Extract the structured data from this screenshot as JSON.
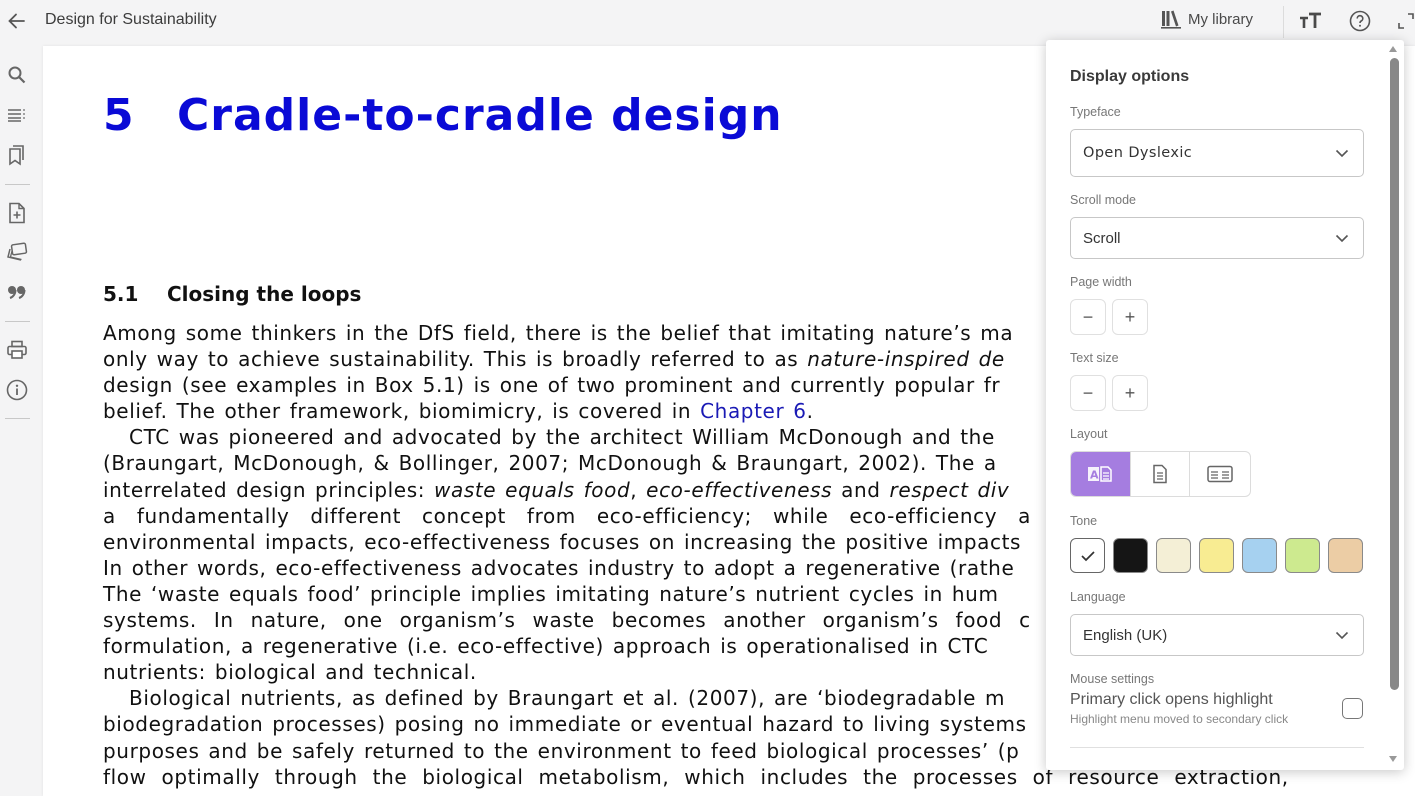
{
  "header": {
    "title": "Design for Sustainability",
    "my_library": "My library",
    "icons": [
      "back-arrow-icon",
      "library-icon",
      "text-size-icon",
      "help-icon",
      "fullscreen-icon"
    ]
  },
  "sidebar": {
    "items": [
      {
        "name": "search",
        "icon": "search-icon"
      },
      {
        "name": "contents",
        "icon": "table-of-contents-icon"
      },
      {
        "name": "bookmarks",
        "icon": "bookmarks-icon"
      },
      {
        "name": "add-note",
        "icon": "add-document-icon"
      },
      {
        "name": "flashcards",
        "icon": "cards-stack-icon"
      },
      {
        "name": "citation",
        "icon": "quote-icon"
      },
      {
        "name": "print",
        "icon": "printer-icon"
      },
      {
        "name": "info",
        "icon": "info-icon"
      }
    ]
  },
  "document": {
    "chapter_number": "5",
    "chapter_title": "Cradle-to-cradle design",
    "section_number": "5.1",
    "section_title": "Closing the loops",
    "p1": {
      "l1": "Among some thinkers in the DfS field, there is the belief that imitating nature’s ma",
      "l2a": "only way to achieve sustainability. This is broadly referred to as ",
      "l2b": "nature-inspired de",
      "l3": "design (see examples in Box 5.1) is one of two prominent and currently popular fr",
      "l4a": "belief. The other framework, biomimicry, is covered in ",
      "l4link": "Chapter 6",
      "l4b": "."
    },
    "p2": {
      "l1": "CTC was pioneered and advocated by the architect William McDonough and the",
      "l2": "(Braungart, McDonough, & Bollinger, 2007; McDonough & Braungart, 2002). The a",
      "l3a": "interrelated design principles: ",
      "l3b": "waste equals food",
      "l3c": ", ",
      "l3d": "eco-effectiveness",
      "l3e": " and ",
      "l3f": "respect div",
      "l4": "a fundamentally different concept from eco-efficiency; while eco-efficiency a",
      "l5": "environmental impacts, eco-effectiveness focuses on increasing the positive impacts",
      "l6": "In other words, eco-effectiveness advocates industry to adopt a regenerative (rathe",
      "l7": "The ‘waste equals food’ principle implies imitating nature’s nutrient cycles in hum",
      "l8": "systems. In nature, one organism’s waste becomes another organism’s food c",
      "l9": "formulation, a regenerative (i.e. eco-effective) approach is operationalised in CTC",
      "l10": "nutrients: biological and technical."
    },
    "p3": {
      "l1": "Biological nutrients, as defined by Braungart et al. (2007), are ‘biodegradable m",
      "l2": "biodegradation processes) posing no immediate or eventual hazard to living systems",
      "l3": "purposes and be safely returned to the environment to feed biological processes’ (p",
      "l4": "flow optimally through the biological metabolism, which includes the processes of resource extraction,"
    }
  },
  "display_options": {
    "title": "Display options",
    "typeface": {
      "label": "Typeface",
      "value": "Open Dyslexic"
    },
    "scroll_mode": {
      "label": "Scroll mode",
      "value": "Scroll"
    },
    "page_width": {
      "label": "Page width",
      "decrease": "−",
      "increase": "+"
    },
    "text_size": {
      "label": "Text size",
      "decrease": "−",
      "increase": "+"
    },
    "layout": {
      "label": "Layout",
      "options": [
        {
          "name": "dyslexia-layout",
          "icon": "dyslexia-layout-icon",
          "selected": true
        },
        {
          "name": "single-page",
          "icon": "single-page-icon",
          "selected": false
        },
        {
          "name": "two-page",
          "icon": "two-page-icon",
          "selected": false
        }
      ]
    },
    "tone": {
      "label": "Tone",
      "selected": "white",
      "options": [
        {
          "name": "white",
          "color": "#ffffff"
        },
        {
          "name": "black",
          "color": "#151515"
        },
        {
          "name": "cream",
          "color": "#f4efd6"
        },
        {
          "name": "yellow",
          "color": "#f8ec92"
        },
        {
          "name": "blue",
          "color": "#a6d1f0"
        },
        {
          "name": "green",
          "color": "#cdea8f"
        },
        {
          "name": "peach",
          "color": "#eccda5"
        }
      ]
    },
    "language": {
      "label": "Language",
      "value": "English (UK)"
    },
    "mouse_settings": {
      "label": "Mouse settings",
      "option_title": "Primary click opens highlight",
      "option_subtitle": "Highlight menu moved to secondary click",
      "checked": false
    }
  },
  "colors": {
    "chapter_heading": "#0a0ad6",
    "link": "#1a1ab5",
    "layout_active": "#a57de0"
  }
}
